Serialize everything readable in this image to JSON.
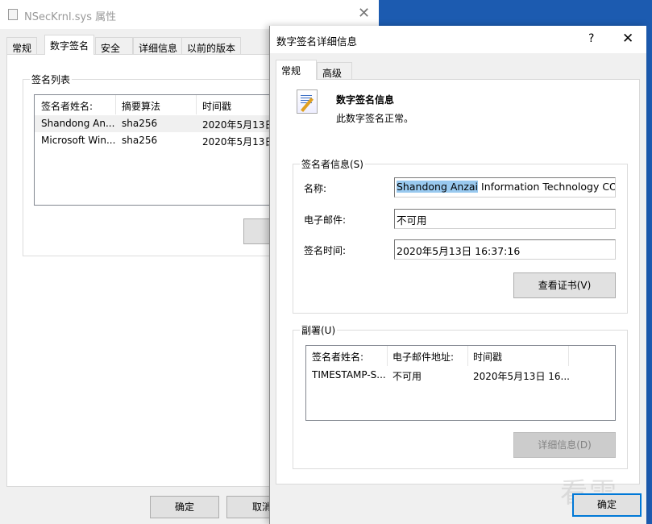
{
  "back_window": {
    "title": "NSecKrnl.sys 属性",
    "close_icon": "close-icon",
    "tabs": [
      "常规",
      "数字签名",
      "安全",
      "详细信息",
      "以前的版本"
    ],
    "active_tab": "数字签名",
    "group_label": "签名列表",
    "columns": [
      "签名者姓名:",
      "摘要算法",
      "时间戳"
    ],
    "rows": [
      {
        "name": "Shandong An...",
        "algo": "sha256",
        "time": "2020年5月13日"
      },
      {
        "name": "Microsoft Win...",
        "algo": "sha256",
        "time": "2020年5月13日"
      }
    ],
    "ok_label": "确定",
    "cancel_label": "取消"
  },
  "dialog": {
    "title": "数字签名详细信息",
    "help_label": "?",
    "tabs": [
      "常规",
      "高级"
    ],
    "heading": "数字签名信息",
    "status": "此数字签名正常。",
    "signer_group": "签名者信息(S)",
    "name_label": "名称:",
    "name_selected": "Shandong Anzai",
    "name_rest": " Information Technology CO.,L",
    "email_label": "电子邮件:",
    "email_value": "不可用",
    "time_label": "签名时间:",
    "time_value": "2020年5月13日 16:37:16",
    "view_cert_label": "查看证书(V)",
    "countersig_group": "副署(U)",
    "columns": [
      "签名者姓名:",
      "电子邮件地址:",
      "时间戳"
    ],
    "rows": [
      {
        "name": "TIMESTAMP-S...",
        "email": "不可用",
        "time": "2020年5月13日 16..."
      }
    ],
    "details_label": "详细信息(D)",
    "ok_label": "确定"
  },
  "watermark": "看雪",
  "colors": {
    "desktop": "#1c5bb0",
    "selection": "#99c9ef",
    "focus": "#0078d7"
  }
}
